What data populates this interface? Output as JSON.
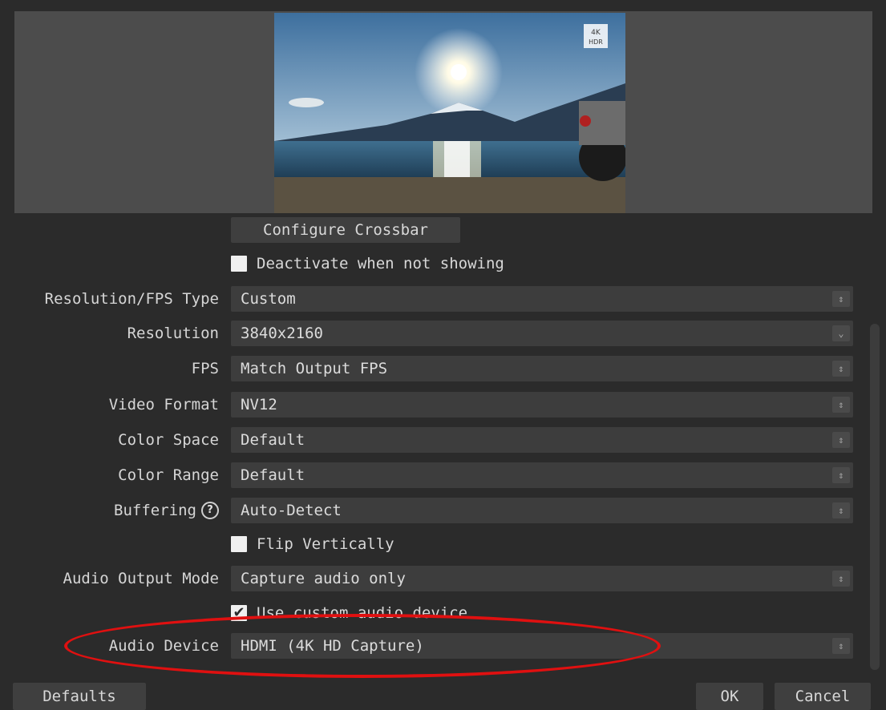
{
  "preview": {
    "badge_lines": [
      "4K",
      "HDR"
    ]
  },
  "configure_crossbar_label": "Configure Crossbar",
  "deactivate_label": "Deactivate when not showing",
  "fields": [
    {
      "label": "Resolution/FPS Type",
      "value": "Custom",
      "arrow": "⇕"
    },
    {
      "label": "Resolution",
      "value": "3840x2160",
      "arrow": "⌄"
    },
    {
      "label": "FPS",
      "value": "Match Output FPS",
      "arrow": "⇕"
    },
    {
      "label": "Video Format",
      "value": "NV12",
      "arrow": "⇕"
    },
    {
      "label": "Color Space",
      "value": "Default",
      "arrow": "⇕"
    },
    {
      "label": "Color Range",
      "value": "Default",
      "arrow": "⇕"
    },
    {
      "label": "Buffering",
      "value": "Auto-Detect",
      "arrow": "⇕"
    }
  ],
  "buffering_help_icon": "?",
  "flip_label": "Flip Vertically",
  "audio_output": {
    "label": "Audio Output Mode",
    "value": "Capture audio only",
    "arrow": "⇕"
  },
  "custom_audio_label": "Use custom audio device",
  "custom_audio_checked": true,
  "check_mark": "✔",
  "audio_device": {
    "label": "Audio Device",
    "value": "HDMI (4K HD Capture)",
    "arrow": "⇕"
  },
  "buttons": {
    "defaults": "Defaults",
    "ok": "OK",
    "cancel": "Cancel"
  },
  "colors": {
    "annotation": "#e01010",
    "background": "#2b2b2b",
    "field": "#3d3d3d"
  }
}
